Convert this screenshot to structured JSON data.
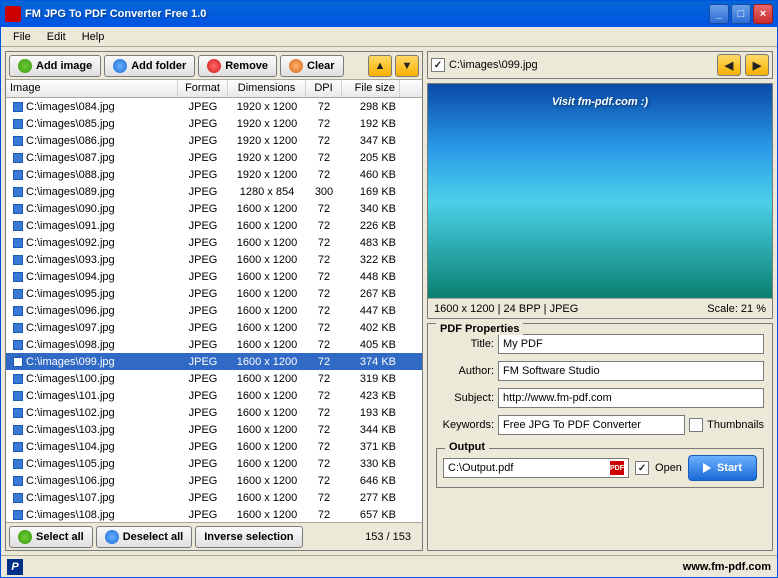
{
  "window": {
    "title": "FM JPG To PDF Converter Free 1.0"
  },
  "menu": {
    "file": "File",
    "edit": "Edit",
    "help": "Help"
  },
  "toolbar": {
    "add_image": "Add image",
    "add_folder": "Add folder",
    "remove": "Remove",
    "clear": "Clear"
  },
  "columns": {
    "image": "Image",
    "format": "Format",
    "dimensions": "Dimensions",
    "dpi": "DPI",
    "filesize": "File size"
  },
  "rows": [
    {
      "path": "C:\\images\\084.jpg",
      "format": "JPEG",
      "dim": "1920 x 1200",
      "dpi": "72",
      "size": "298 KB"
    },
    {
      "path": "C:\\images\\085.jpg",
      "format": "JPEG",
      "dim": "1920 x 1200",
      "dpi": "72",
      "size": "192 KB"
    },
    {
      "path": "C:\\images\\086.jpg",
      "format": "JPEG",
      "dim": "1920 x 1200",
      "dpi": "72",
      "size": "347 KB"
    },
    {
      "path": "C:\\images\\087.jpg",
      "format": "JPEG",
      "dim": "1920 x 1200",
      "dpi": "72",
      "size": "205 KB"
    },
    {
      "path": "C:\\images\\088.jpg",
      "format": "JPEG",
      "dim": "1920 x 1200",
      "dpi": "72",
      "size": "460 KB"
    },
    {
      "path": "C:\\images\\089.jpg",
      "format": "JPEG",
      "dim": "1280 x 854",
      "dpi": "300",
      "size": "169 KB"
    },
    {
      "path": "C:\\images\\090.jpg",
      "format": "JPEG",
      "dim": "1600 x 1200",
      "dpi": "72",
      "size": "340 KB"
    },
    {
      "path": "C:\\images\\091.jpg",
      "format": "JPEG",
      "dim": "1600 x 1200",
      "dpi": "72",
      "size": "226 KB"
    },
    {
      "path": "C:\\images\\092.jpg",
      "format": "JPEG",
      "dim": "1600 x 1200",
      "dpi": "72",
      "size": "483 KB"
    },
    {
      "path": "C:\\images\\093.jpg",
      "format": "JPEG",
      "dim": "1600 x 1200",
      "dpi": "72",
      "size": "322 KB"
    },
    {
      "path": "C:\\images\\094.jpg",
      "format": "JPEG",
      "dim": "1600 x 1200",
      "dpi": "72",
      "size": "448 KB"
    },
    {
      "path": "C:\\images\\095.jpg",
      "format": "JPEG",
      "dim": "1600 x 1200",
      "dpi": "72",
      "size": "267 KB"
    },
    {
      "path": "C:\\images\\096.jpg",
      "format": "JPEG",
      "dim": "1600 x 1200",
      "dpi": "72",
      "size": "447 KB"
    },
    {
      "path": "C:\\images\\097.jpg",
      "format": "JPEG",
      "dim": "1600 x 1200",
      "dpi": "72",
      "size": "402 KB"
    },
    {
      "path": "C:\\images\\098.jpg",
      "format": "JPEG",
      "dim": "1600 x 1200",
      "dpi": "72",
      "size": "405 KB"
    },
    {
      "path": "C:\\images\\099.jpg",
      "format": "JPEG",
      "dim": "1600 x 1200",
      "dpi": "72",
      "size": "374 KB",
      "selected": true
    },
    {
      "path": "C:\\images\\100.jpg",
      "format": "JPEG",
      "dim": "1600 x 1200",
      "dpi": "72",
      "size": "319 KB"
    },
    {
      "path": "C:\\images\\101.jpg",
      "format": "JPEG",
      "dim": "1600 x 1200",
      "dpi": "72",
      "size": "423 KB"
    },
    {
      "path": "C:\\images\\102.jpg",
      "format": "JPEG",
      "dim": "1600 x 1200",
      "dpi": "72",
      "size": "193 KB"
    },
    {
      "path": "C:\\images\\103.jpg",
      "format": "JPEG",
      "dim": "1600 x 1200",
      "dpi": "72",
      "size": "344 KB"
    },
    {
      "path": "C:\\images\\104.jpg",
      "format": "JPEG",
      "dim": "1600 x 1200",
      "dpi": "72",
      "size": "371 KB"
    },
    {
      "path": "C:\\images\\105.jpg",
      "format": "JPEG",
      "dim": "1600 x 1200",
      "dpi": "72",
      "size": "330 KB"
    },
    {
      "path": "C:\\images\\106.jpg",
      "format": "JPEG",
      "dim": "1600 x 1200",
      "dpi": "72",
      "size": "646 KB"
    },
    {
      "path": "C:\\images\\107.jpg",
      "format": "JPEG",
      "dim": "1600 x 1200",
      "dpi": "72",
      "size": "277 KB"
    },
    {
      "path": "C:\\images\\108.jpg",
      "format": "JPEG",
      "dim": "1600 x 1200",
      "dpi": "72",
      "size": "657 KB"
    }
  ],
  "bottom": {
    "select_all": "Select all",
    "deselect_all": "Deselect all",
    "inverse": "Inverse selection",
    "count": "153 / 153"
  },
  "preview": {
    "path": "C:\\images\\099.jpg",
    "overlay": "Visit fm-pdf.com :)",
    "status_left": "1600 x 1200 | 24 BPP | JPEG",
    "status_right": "Scale: 21 %"
  },
  "props": {
    "section": "PDF Properties",
    "title_label": "Title:",
    "title": "My PDF",
    "author_label": "Author:",
    "author": "FM Software Studio",
    "subject_label": "Subject:",
    "subject": "http://www.fm-pdf.com",
    "keywords_label": "Keywords:",
    "keywords": "Free JPG To PDF Converter",
    "thumbnails": "Thumbnails"
  },
  "output": {
    "section": "Output",
    "path": "C:\\Output.pdf",
    "open": "Open",
    "start": "Start"
  },
  "statusbar": {
    "site": "www.fm-pdf.com"
  }
}
